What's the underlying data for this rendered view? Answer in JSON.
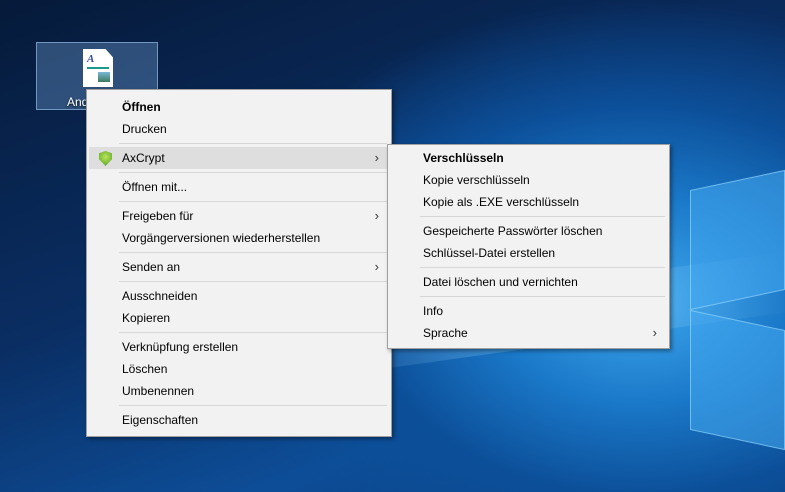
{
  "desktop": {
    "icon_label": "And"
  },
  "context_menu": {
    "items": [
      {
        "label": "Öffnen",
        "bold": true
      },
      {
        "label": "Drucken"
      },
      {
        "sep": true
      },
      {
        "label": "AxCrypt",
        "icon": "axcrypt-shield-icon",
        "submenu": true,
        "highlighted": true
      },
      {
        "sep": true
      },
      {
        "label": "Öffnen mit..."
      },
      {
        "sep": true
      },
      {
        "label": "Freigeben für",
        "submenu": true
      },
      {
        "label": "Vorgängerversionen wiederherstellen"
      },
      {
        "sep": true
      },
      {
        "label": "Senden an",
        "submenu": true
      },
      {
        "sep": true
      },
      {
        "label": "Ausschneiden"
      },
      {
        "label": "Kopieren"
      },
      {
        "sep": true
      },
      {
        "label": "Verknüpfung erstellen"
      },
      {
        "label": "Löschen"
      },
      {
        "label": "Umbenennen"
      },
      {
        "sep": true
      },
      {
        "label": "Eigenschaften"
      }
    ]
  },
  "axcrypt_submenu": {
    "items": [
      {
        "label": "Verschlüsseln",
        "bold": true
      },
      {
        "label": "Kopie verschlüsseln"
      },
      {
        "label": "Kopie als .EXE verschlüsseln"
      },
      {
        "sep": true
      },
      {
        "label": "Gespeicherte Passwörter löschen"
      },
      {
        "label": "Schlüssel-Datei erstellen"
      },
      {
        "sep": true
      },
      {
        "label": "Datei löschen und vernichten"
      },
      {
        "sep": true
      },
      {
        "label": "Info"
      },
      {
        "label": "Sprache",
        "submenu": true
      }
    ]
  },
  "chevron": "›"
}
